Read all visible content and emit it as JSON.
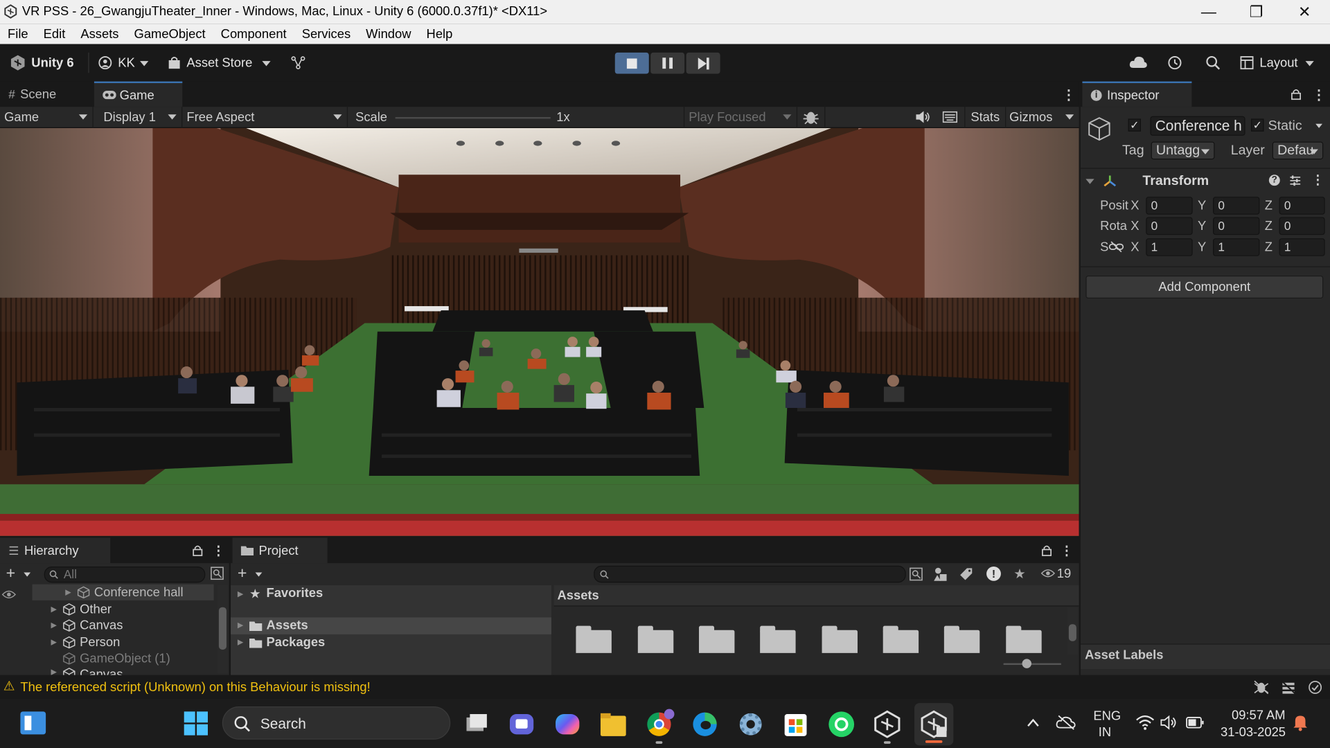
{
  "window": {
    "title": "VR PSS - 26_GwangjuTheater_Inner - Windows, Mac, Linux - Unity 6 (6000.0.37f1)* <DX11>",
    "minimize": "—",
    "maximize": "❐",
    "close": "✕"
  },
  "menu": [
    "File",
    "Edit",
    "Assets",
    "GameObject",
    "Component",
    "Services",
    "Window",
    "Help"
  ],
  "toolbar": {
    "unity_label": "Unity 6",
    "account": "KK",
    "asset_store": "Asset Store",
    "layout": "Layout"
  },
  "tabs": {
    "scene": "Scene",
    "game": "Game",
    "inspector": "Inspector",
    "hierarchy": "Hierarchy",
    "project": "Project"
  },
  "gamebar": {
    "mode": "Game",
    "display": "Display 1",
    "aspect": "Free Aspect",
    "scale_label": "Scale",
    "scale_value": "1x",
    "play_focused": "Play Focused",
    "stats": "Stats",
    "gizmos": "Gizmos"
  },
  "inspector": {
    "object_name": "Conference h",
    "static_label": "Static",
    "tag_label": "Tag",
    "tag_value": "Untagg",
    "layer_label": "Layer",
    "layer_value": "Defau",
    "transform_title": "Transform",
    "position_label": "Posit",
    "rotation_label": "Rota",
    "scale_label": "S",
    "axis_x": "X",
    "axis_y": "Y",
    "axis_z": "Z",
    "position": [
      "0",
      "0",
      "0"
    ],
    "rotation": [
      "0",
      "0",
      "0"
    ],
    "scale": [
      "1",
      "1",
      "1"
    ],
    "add_component": "Add Component",
    "asset_labels": "Asset Labels"
  },
  "hierarchy": {
    "search_placeholder": "All",
    "items": [
      {
        "label": "Conference hall"
      },
      {
        "label": "Other"
      },
      {
        "label": "Canvas"
      },
      {
        "label": "Person"
      },
      {
        "label": "GameObject (1)"
      },
      {
        "label": "Canvas"
      }
    ]
  },
  "project": {
    "favorites": "Favorites",
    "assets": "Assets",
    "packages": "Packages",
    "breadcrumb": "Assets",
    "hidden_count": "19"
  },
  "status": {
    "warning": "The referenced script (Unknown) on this Behaviour is missing!"
  },
  "taskbar": {
    "search": "Search",
    "lang_line1": "ENG",
    "lang_line2": "IN",
    "time": "09:57 AM",
    "date": "31-03-2025"
  }
}
